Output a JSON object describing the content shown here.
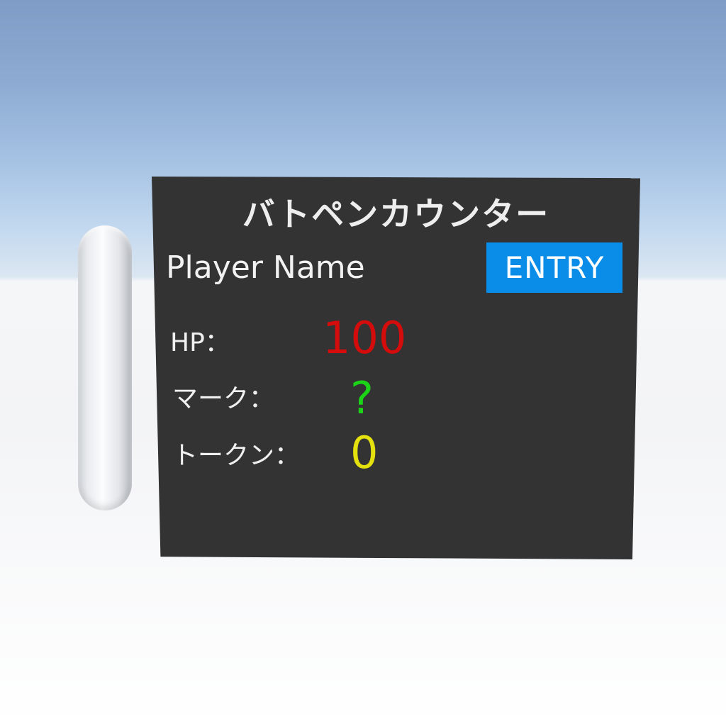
{
  "counter": {
    "title": "バトペンカウンター",
    "player_name": "Player Name",
    "entry_label": "ENTRY",
    "stats": {
      "hp": {
        "label": "HP：",
        "value": "100",
        "color": "#d40c0c"
      },
      "mark": {
        "label": "マーク：",
        "value": "?",
        "color": "#1bd418"
      },
      "token": {
        "label": "トークン：",
        "value": "0",
        "color": "#e4e10f"
      }
    },
    "panel_color": "#333333",
    "button_color": "#0a8de8"
  }
}
